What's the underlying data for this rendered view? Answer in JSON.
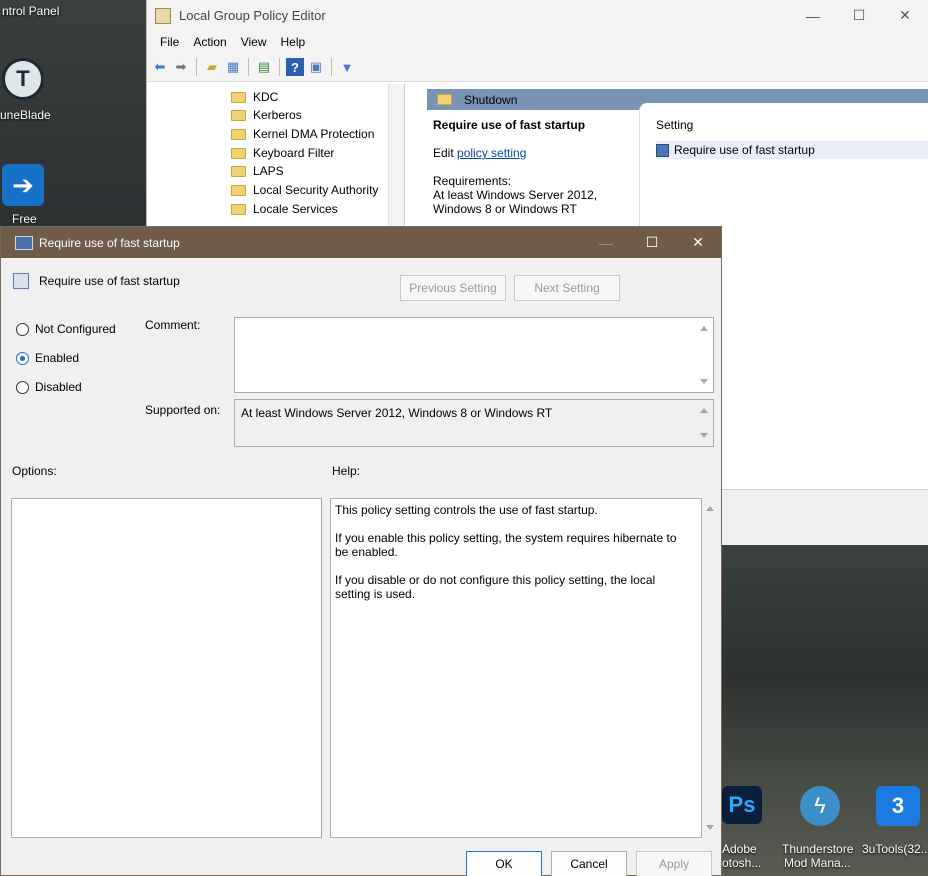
{
  "desktop": {
    "top_left_label": "ntrol Panel",
    "app1_label": "uneBlade",
    "app2_label": "Free",
    "taskbar_apps": [
      {
        "label_line1": "Adobe",
        "label_line2": "otosh..."
      },
      {
        "label_line1": "Thunderstore",
        "label_line2": "Mod Mana..."
      },
      {
        "label_line1": "3uTools(32...",
        "label_line2": ""
      }
    ],
    "ps_text": "Ps"
  },
  "gpe": {
    "title": "Local Group Policy Editor",
    "menu": [
      "File",
      "Action",
      "View",
      "Help"
    ],
    "tree_items": [
      "KDC",
      "Kerberos",
      "Kernel DMA Protection",
      "Keyboard Filter",
      "LAPS",
      "Local Security Authority",
      "Locale Services"
    ],
    "detail_header": "Shutdown",
    "extended": {
      "policy_title": "Require use of fast startup",
      "edit_prefix": "Edit ",
      "edit_link": "policy setting",
      "requirements_label": "Requirements:",
      "requirements_value": "At least Windows Server 2012, Windows 8 or Windows RT"
    },
    "list_header": "Setting",
    "list_rows": [
      "Require use of fast startup"
    ]
  },
  "dialog": {
    "title": "Require use of fast startup",
    "policy_name": "Require use of fast startup",
    "previous_label": "Previous Setting",
    "next_label": "Next Setting",
    "radios": [
      {
        "label": "Not Configured",
        "checked": false
      },
      {
        "label": "Enabled",
        "checked": true
      },
      {
        "label": "Disabled",
        "checked": false
      }
    ],
    "comment_label": "Comment:",
    "supported_label": "Supported on:",
    "supported_value": "At least Windows Server 2012, Windows 8 or Windows RT",
    "options_label": "Options:",
    "help_label": "Help:",
    "help_paragraphs": [
      "This policy setting controls the use of fast startup.",
      "If you enable this policy setting, the system requires hibernate to be enabled.",
      "If you disable or do not configure this policy setting, the local setting is used."
    ],
    "ok_label": "OK",
    "cancel_label": "Cancel",
    "apply_label": "Apply"
  },
  "colors": {
    "dialog_title_bar": "#6f5d4a",
    "detail_header": "#7993b6",
    "accent": "#1f6fd4"
  }
}
